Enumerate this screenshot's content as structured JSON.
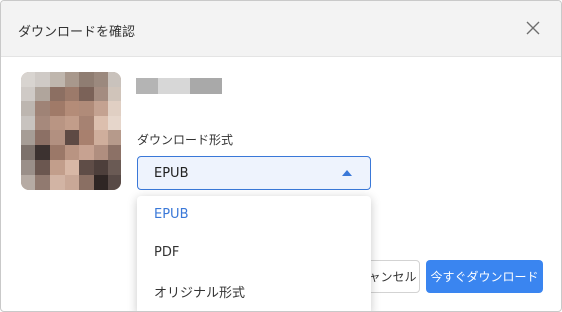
{
  "dialog": {
    "title": "ダウンロードを確認",
    "close_icon": "close-icon"
  },
  "book": {
    "cover_icon": "book-cover-thumbnail-pixelated",
    "title_obscured": true
  },
  "format": {
    "label": "ダウンロード形式",
    "selected": "EPUB",
    "caret_icon": "caret-up-icon",
    "options": [
      {
        "label": "EPUB",
        "selected": true
      },
      {
        "label": "PDF",
        "selected": false
      },
      {
        "label": "オリジナル形式",
        "selected": false
      }
    ]
  },
  "buttons": {
    "cancel_label": "キャンセル",
    "download_label": "今すぐダウンロード"
  },
  "colors": {
    "accent": "#3a78d8",
    "primary_button": "#3a85f0",
    "titlebar_bg": "#f3f3f3",
    "select_bg": "#eef3fd"
  }
}
